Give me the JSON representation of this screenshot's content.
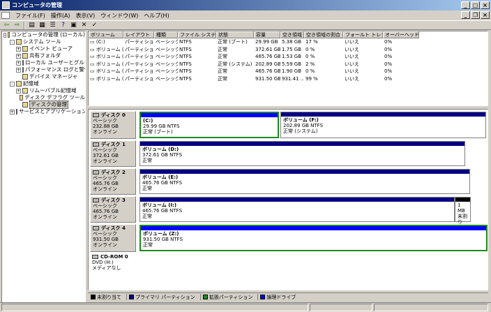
{
  "window": {
    "title": "コンピュータの管理"
  },
  "menu": [
    "ファイル(F)",
    "操作(A)",
    "表示(V)",
    "ウィンドウ(W)",
    "ヘルプ(H)"
  ],
  "tree": [
    {
      "label": "コンピュータの管理 (ローカル)",
      "level": 0,
      "exp": "-"
    },
    {
      "label": "システム ツール",
      "level": 1,
      "exp": "-"
    },
    {
      "label": "イベント ビューア",
      "level": 2,
      "exp": "+"
    },
    {
      "label": "共有フォルダ",
      "level": 2,
      "exp": "+"
    },
    {
      "label": "ローカル ユーザーとグループ",
      "level": 2,
      "exp": "+"
    },
    {
      "label": "パフォーマンス ログと警告",
      "level": 2,
      "exp": "+"
    },
    {
      "label": "デバイス マネージャ",
      "level": 2,
      "exp": ""
    },
    {
      "label": "記憶域",
      "level": 1,
      "exp": "-"
    },
    {
      "label": "リムーバブル記憶域",
      "level": 2,
      "exp": "+"
    },
    {
      "label": "ディスク デフラグ ツール",
      "level": 2,
      "exp": ""
    },
    {
      "label": "ディスクの管理",
      "level": 2,
      "exp": "",
      "selected": true
    },
    {
      "label": "サービスとアプリケーション",
      "level": 1,
      "exp": "+"
    }
  ],
  "volume_list": {
    "headers": [
      "ボリューム",
      "レイアウト",
      "種類",
      "ファイル システム",
      "状態",
      "容量",
      "空き領域",
      "空き領域の割合",
      "フォールト トレランス",
      "オーバーヘッド"
    ],
    "rows": [
      [
        "(C:)",
        "パーティション",
        "ベーシック",
        "NTFS",
        "正常 (ブート)",
        "29.99 GB",
        "5.38 GB",
        "17 %",
        "いいえ",
        "0%"
      ],
      [
        "ボリューム (D:)",
        "パーティション",
        "ベーシック",
        "NTFS",
        "正常",
        "372.61 GB",
        "1.75 GB",
        "0 %",
        "いいえ",
        "0%"
      ],
      [
        "ボリューム (E:)",
        "パーティション",
        "ベーシック",
        "NTFS",
        "正常",
        "465.76 GB",
        "1.53 GB",
        "0 %",
        "いいえ",
        "0%"
      ],
      [
        "ボリューム (F:)",
        "パーティション",
        "ベーシック",
        "NTFS",
        "正常 (システム)",
        "202.89 GB",
        "5.59 GB",
        "2 %",
        "いいえ",
        "0%"
      ],
      [
        "ボリューム (I:)",
        "パーティション",
        "ベーシック",
        "NTFS",
        "正常",
        "465.76 GB",
        "1.90 GB",
        "0 %",
        "いいえ",
        "0%"
      ],
      [
        "ボリューム (Z:)",
        "パーティション",
        "ベーシック",
        "NTFS",
        "正常",
        "931.50 GB",
        "931.41 ...",
        "99 %",
        "いいえ",
        "0%"
      ]
    ]
  },
  "disks": [
    {
      "name": "ディスク 0",
      "type": "ベーシック",
      "size": "232.88 GB",
      "status": "オンライン",
      "partitions": [
        {
          "name": "(C:)",
          "detail": "29.99 GB NTFS",
          "status": "正常 (ブート)",
          "color": "#0000ff",
          "selected": true
        },
        {
          "name": "ボリューム  (F:)",
          "detail": "202.89 GB NTFS",
          "status": "正常 (システム)",
          "color": "#000080"
        }
      ]
    },
    {
      "name": "ディスク 1",
      "type": "ベーシック",
      "size": "372.61 GB",
      "status": "オンライン",
      "partitions": [
        {
          "name": "ボリューム  (D:)",
          "detail": "372.61 GB NTFS",
          "status": "正常",
          "color": "#000080"
        }
      ]
    },
    {
      "name": "ディスク 2",
      "type": "ベーシック",
      "size": "465.76 GB",
      "status": "オンライン",
      "partitions": [
        {
          "name": "ボリューム  (E:)",
          "detail": "465.76 GB NTFS",
          "status": "正常",
          "color": "#000080"
        }
      ]
    },
    {
      "name": "ディスク 3",
      "type": "ベーシック",
      "size": "465.76 GB",
      "status": "オンライン",
      "partitions": [
        {
          "name": "ボリューム  (I:)",
          "detail": "465.76 GB NTFS",
          "status": "正常",
          "color": "#000080"
        },
        {
          "name": "",
          "detail": "1 MB",
          "status": "未割り",
          "color": "#000000"
        }
      ]
    },
    {
      "name": "ディスク 4",
      "type": "ベーシック",
      "size": "931.50 GB",
      "status": "オンライン",
      "partitions": [
        {
          "name": "ボリューム  (Z:)",
          "detail": "931.50 GB NTFS",
          "status": "正常",
          "color": "#0000ff",
          "selected": true
        }
      ]
    },
    {
      "name": "CD-ROM 0",
      "type": "DVD (H:)",
      "size": "",
      "status": "メディアなし",
      "partitions": []
    }
  ],
  "legend": [
    {
      "label": "未割り当て",
      "color": "#000000"
    },
    {
      "label": "プライマリ パーティション",
      "color": "#000080"
    },
    {
      "label": "拡張パーティション",
      "color": "#1e8a1e"
    },
    {
      "label": "論理ドライブ",
      "color": "#0000ff"
    }
  ]
}
